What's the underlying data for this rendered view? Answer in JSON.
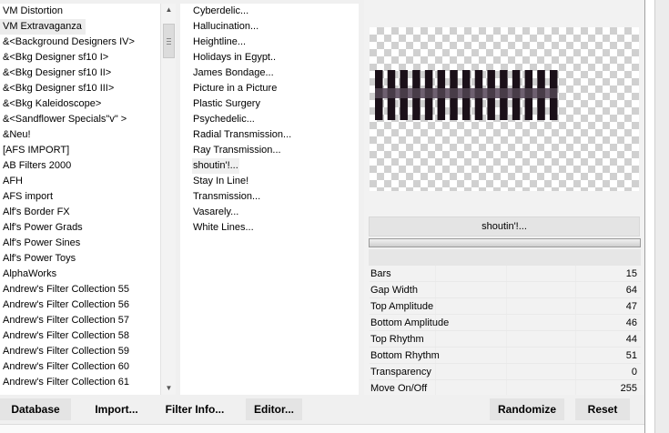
{
  "categories": {
    "items": [
      "VM Distortion",
      "VM Extravaganza",
      "&<Background Designers IV>",
      "&<Bkg Designer sf10 I>",
      "&<Bkg Designer sf10 II>",
      "&<Bkg Designer sf10 III>",
      "&<Bkg Kaleidoscope>",
      "&<Sandflower Specials\"v\" >",
      "&Neu!",
      "[AFS IMPORT]",
      "AB Filters 2000",
      "AFH",
      "AFS import",
      "Alf's Border FX",
      "Alf's Power Grads",
      "Alf's Power Sines",
      "Alf's Power Toys",
      "AlphaWorks",
      "Andrew's Filter Collection 55",
      "Andrew's Filter Collection 56",
      "Andrew's Filter Collection 57",
      "Andrew's Filter Collection 58",
      "Andrew's Filter Collection 59",
      "Andrew's Filter Collection 60",
      "Andrew's Filter Collection 61"
    ],
    "selected_index": 1
  },
  "filters": {
    "items": [
      "Cyberdelic...",
      "Hallucination...",
      "Heightline...",
      "Holidays in Egypt..",
      "James Bondage...",
      "Picture in a Picture",
      "Plastic Surgery",
      "Psychedelic...",
      "Radial Transmission...",
      "Ray Transmission...",
      "shoutin'!...",
      "Stay In Line!",
      "Transmission...",
      "Vasarely...",
      "White Lines..."
    ],
    "selected_index": 10
  },
  "preview": {
    "bar_count": 15,
    "colors": {
      "dark": "#1b1019",
      "light": "#6e6070",
      "checker": "#d0d0d0"
    }
  },
  "panel": {
    "filter_name": "shoutin'!...",
    "progress": 1.0
  },
  "params": [
    {
      "label": "Bars",
      "value": "15"
    },
    {
      "label": "Gap Width",
      "value": "64"
    },
    {
      "label": "Top Amplitude",
      "value": "47"
    },
    {
      "label": "Bottom Amplitude",
      "value": "46"
    },
    {
      "label": "Top Rhythm",
      "value": "44"
    },
    {
      "label": "Bottom Rhythm",
      "value": "51"
    },
    {
      "label": "Transparency",
      "value": "0"
    },
    {
      "label": "Move On/Off",
      "value": "255"
    }
  ],
  "buttons": {
    "database": "Database",
    "import": "Import...",
    "filter_info": "Filter Info...",
    "editor": "Editor...",
    "randomize": "Randomize",
    "reset": "Reset"
  },
  "icons": {
    "scroll_up": "scroll-up-arrow-icon",
    "scroll_down": "scroll-down-arrow-icon"
  }
}
